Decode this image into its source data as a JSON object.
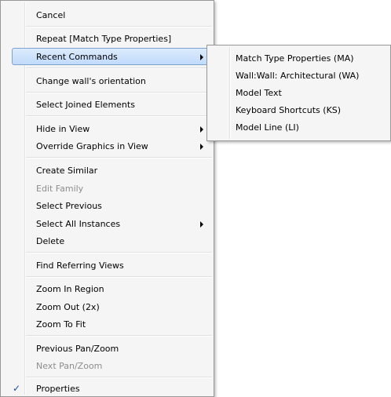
{
  "context_menu": {
    "items": [
      {
        "label": "Cancel"
      },
      {
        "label": "Repeat [Match Type Properties]"
      },
      {
        "label": "Recent Commands"
      },
      {
        "label": "Change wall's orientation"
      },
      {
        "label": "Select Joined Elements"
      },
      {
        "label": "Hide in View"
      },
      {
        "label": "Override Graphics in View"
      },
      {
        "label": "Create Similar"
      },
      {
        "label": "Edit Family"
      },
      {
        "label": "Select Previous"
      },
      {
        "label": "Select All Instances"
      },
      {
        "label": "Delete"
      },
      {
        "label": "Find Referring Views"
      },
      {
        "label": "Zoom In Region"
      },
      {
        "label": "Zoom Out (2x)"
      },
      {
        "label": "Zoom To Fit"
      },
      {
        "label": "Previous Pan/Zoom"
      },
      {
        "label": "Next Pan/Zoom"
      },
      {
        "label": "Properties",
        "checked": true
      }
    ],
    "check_glyph": "✓"
  },
  "recent_commands_submenu": {
    "items": [
      {
        "label": "Match Type Properties (MA)"
      },
      {
        "label": "Wall:Wall: Architectural (WA)"
      },
      {
        "label": "Model Text"
      },
      {
        "label": "Keyboard Shortcuts (KS)"
      },
      {
        "label": "Model Line (LI)"
      }
    ]
  },
  "colors": {
    "highlight_border": "#7da2ce",
    "highlight_fill": "#c1dbfc",
    "disabled_text": "#8d8d8d"
  }
}
